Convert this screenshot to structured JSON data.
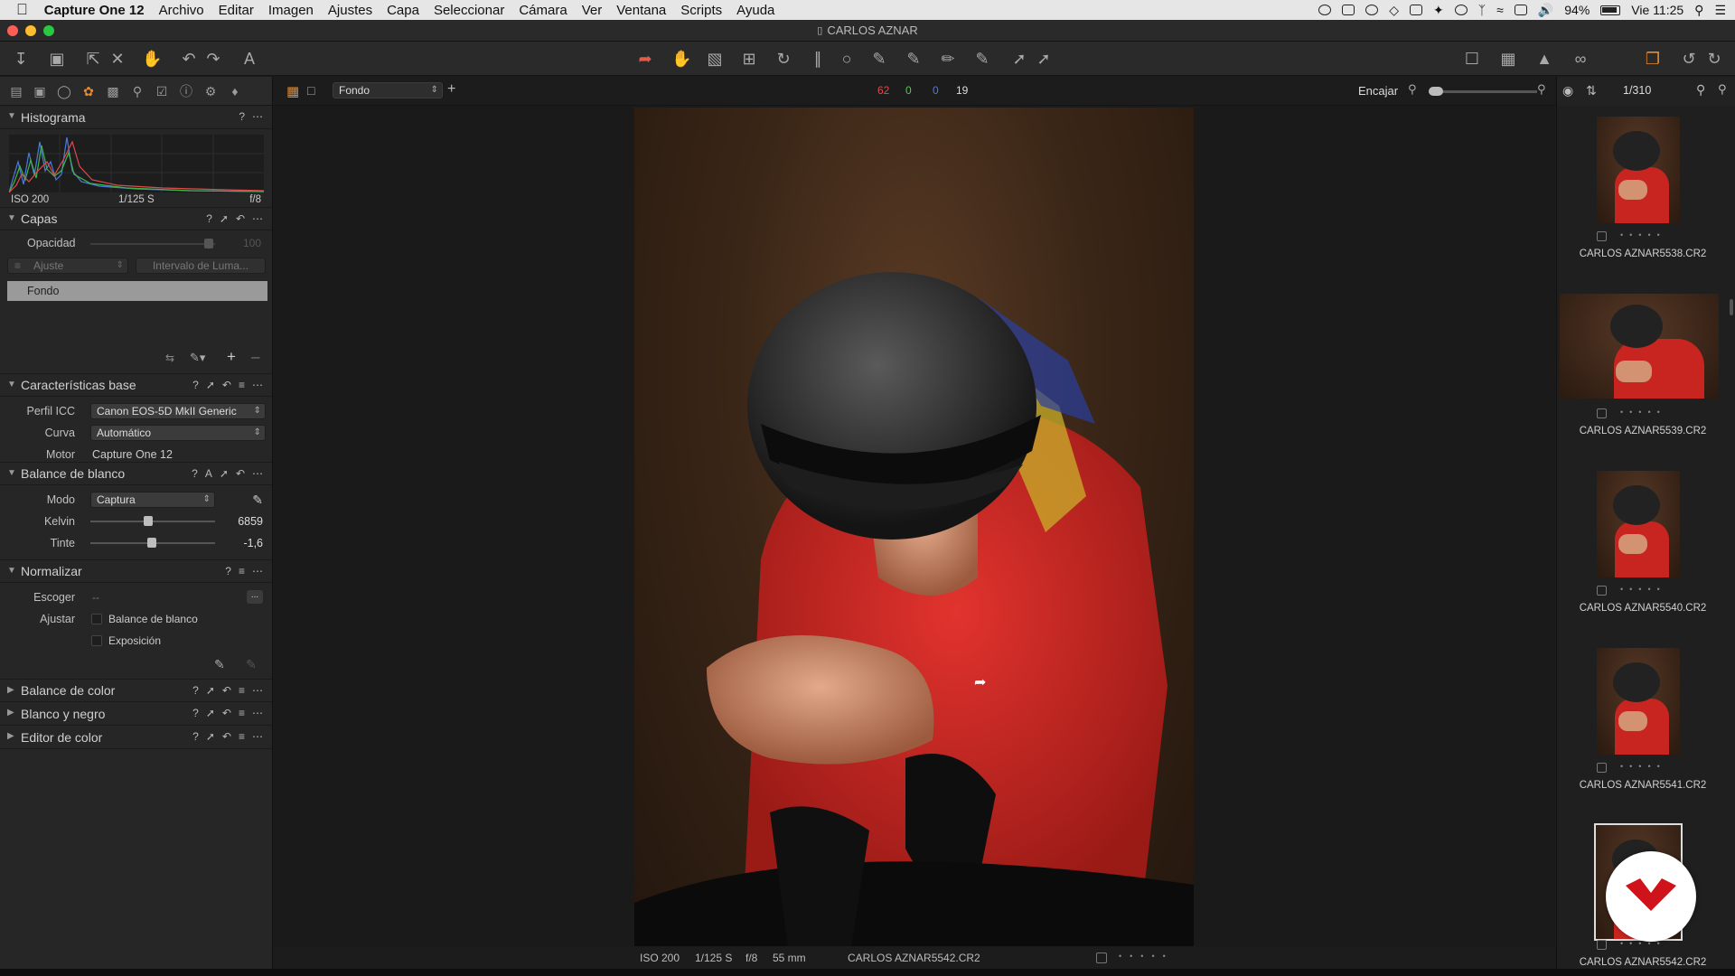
{
  "menubar": {
    "app": "Capture One 12",
    "items": [
      "Archivo",
      "Editar",
      "Imagen",
      "Ajustes",
      "Capa",
      "Seleccionar",
      "Cámara",
      "Ver",
      "Ventana",
      "Scripts",
      "Ayuda"
    ],
    "battery": "94%",
    "clock": "Vie 11:25"
  },
  "window": {
    "title": "CARLOS AZNAR"
  },
  "viewer": {
    "layer_select": "Fondo",
    "counts": {
      "red": "62",
      "green": "0",
      "blue": "0",
      "total": "19"
    },
    "zoom_label": "Encajar"
  },
  "browser": {
    "counter": "1/310"
  },
  "histogram": {
    "title": "Histograma",
    "iso": "ISO 200",
    "shutter": "1/125 S",
    "aperture": "f/8"
  },
  "layers": {
    "title": "Capas",
    "opacity_label": "Opacidad",
    "opacity_value": "100",
    "adjust_label": "Ajuste",
    "luma_label": "Intervalo de Luma...",
    "layer_name": "Fondo"
  },
  "base": {
    "title": "Características base",
    "icc_label": "Perfil ICC",
    "icc_value": "Canon EOS-5D MkII Generic",
    "curve_label": "Curva",
    "curve_value": "Automático",
    "engine_label": "Motor",
    "engine_value": "Capture One 12"
  },
  "wb": {
    "title": "Balance de blanco",
    "mode_label": "Modo",
    "mode_value": "Captura",
    "kelvin_label": "Kelvin",
    "kelvin_value": "6859",
    "tint_label": "Tinte",
    "tint_value": "-1,6",
    "kelvin_pos": 0.46,
    "tint_pos": 0.49
  },
  "normalize": {
    "title": "Normalizar",
    "pick_label": "Escoger",
    "pick_value": "--",
    "pick_button": "...",
    "adjust_label": "Ajustar",
    "opt1": "Balance de blanco",
    "opt2": "Exposición"
  },
  "collapsed": [
    "Balance de color",
    "Blanco y negro",
    "Editor de color"
  ],
  "status": {
    "iso": "ISO 200",
    "shutter": "1/125 S",
    "aperture": "f/8",
    "focal": "55 mm",
    "filename": "CARLOS AZNAR5542.CR2"
  },
  "thumbnails": [
    {
      "name": "CARLOS AZNAR5538.CR2"
    },
    {
      "name": "CARLOS AZNAR5539.CR2"
    },
    {
      "name": "CARLOS AZNAR5540.CR2"
    },
    {
      "name": "CARLOS AZNAR5541.CR2"
    },
    {
      "name": "CARLOS AZNAR5542.CR2"
    }
  ],
  "colors": {
    "accent": "#e88a2d",
    "badge": "#d0121b"
  }
}
